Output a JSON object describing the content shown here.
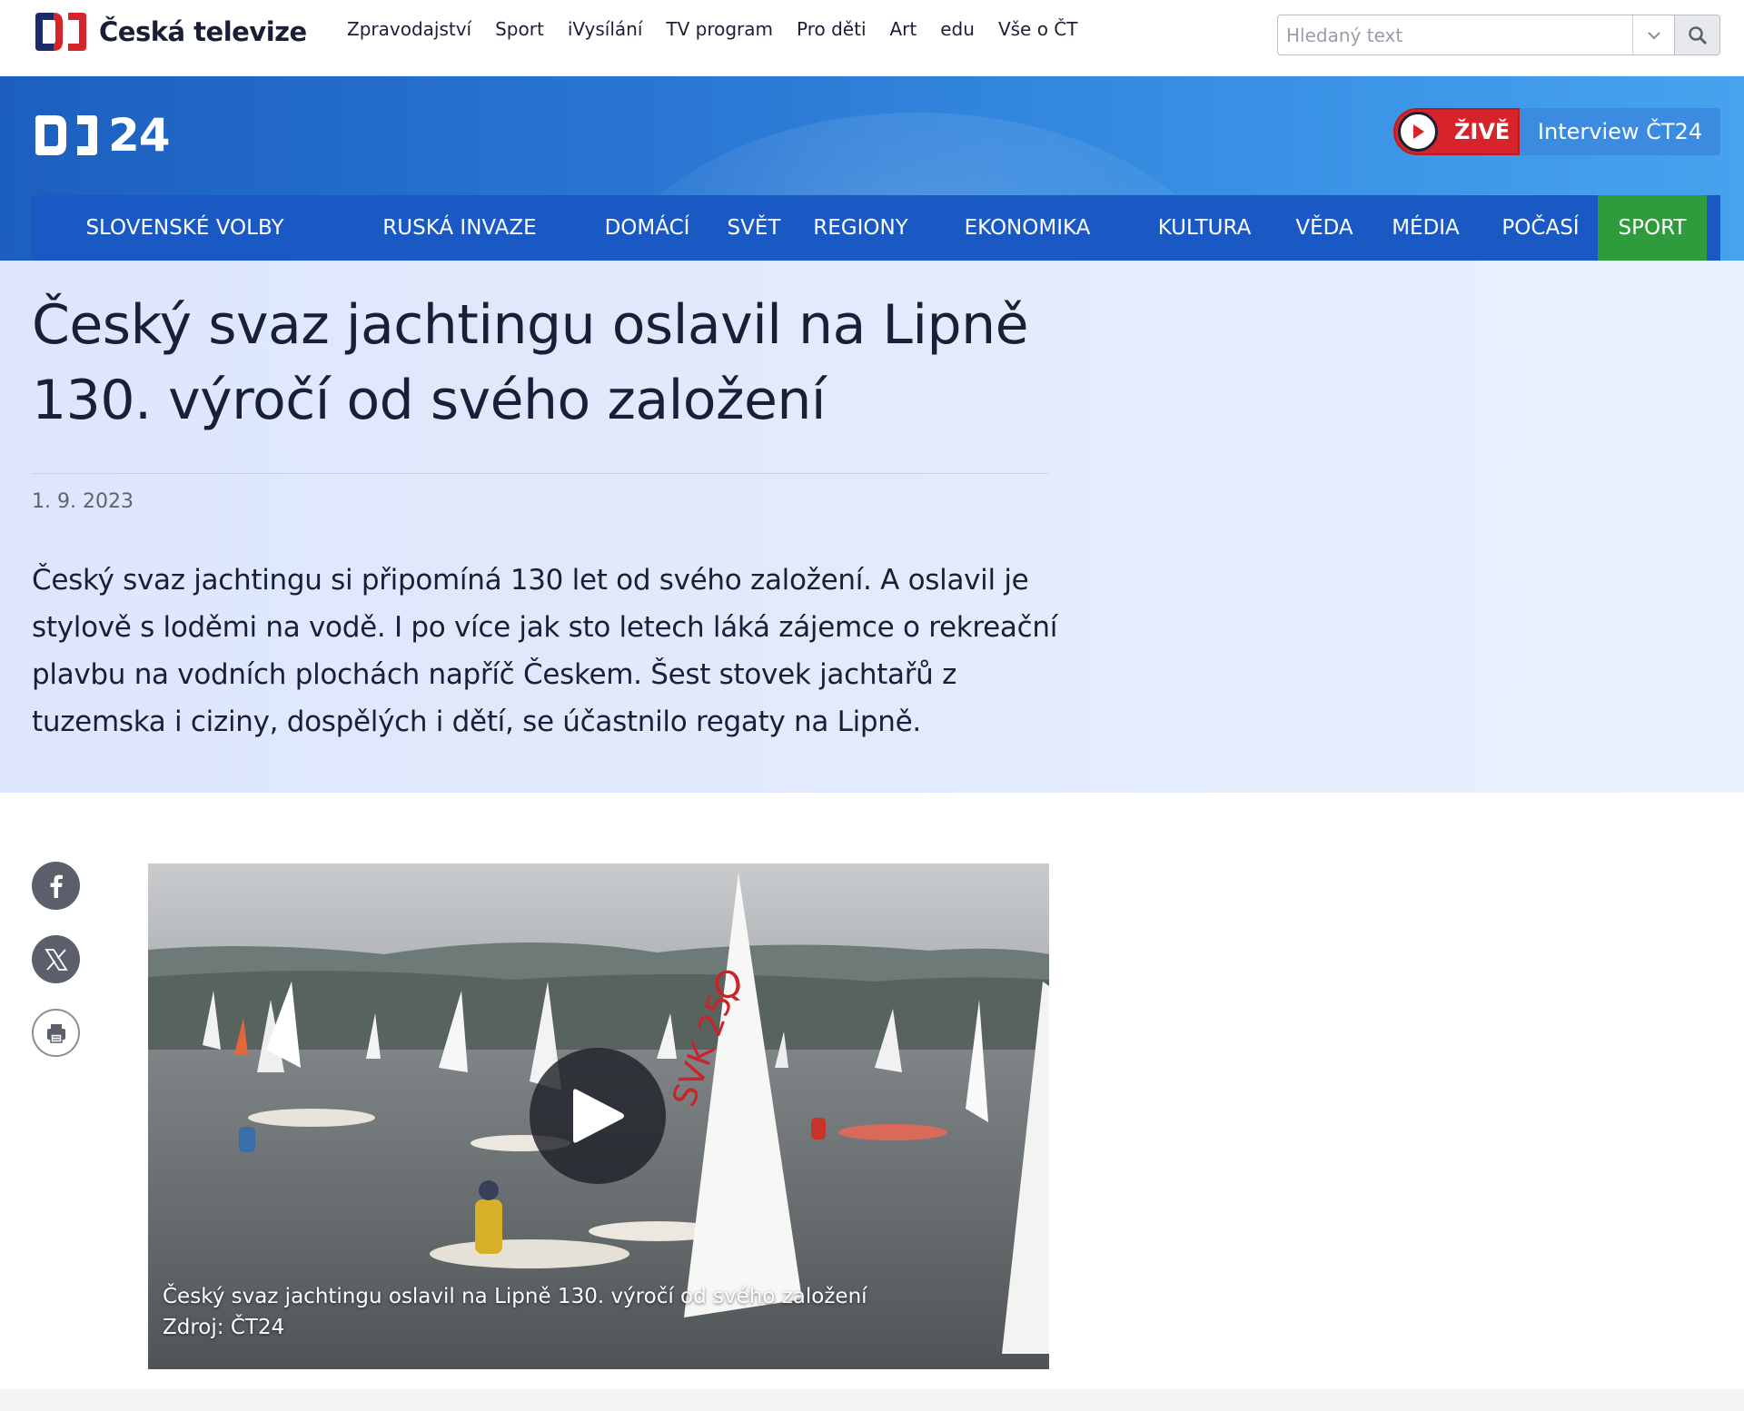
{
  "topbar": {
    "brand": "Česká televize",
    "nav": [
      "Zpravodajství",
      "Sport",
      "iVysílání",
      "TV program",
      "Pro děti",
      "Art",
      "edu",
      "Vše o ČT"
    ],
    "search_placeholder": "Hledaný text"
  },
  "header": {
    "logo_text": "24",
    "live_label": "ŽIVĚ",
    "interview_label": "Interview ČT24"
  },
  "sections": [
    "SLOVENSKÉ VOLBY",
    "RUSKÁ INVAZE",
    "DOMÁCÍ",
    "SVĚT",
    "REGIONY",
    "EKONOMIKA",
    "KULTURA",
    "VĚDA",
    "MÉDIA",
    "POČASÍ",
    "SPORT"
  ],
  "article": {
    "title": "Český svaz jachtingu oslavil na Lipně 130. výročí od svého založení",
    "date": "1. 9. 2023",
    "perex": "Český svaz jachtingu si připomíná 130 let od svého založení.  A oslavil je stylově s loděmi na vodě. I po více jak sto letech láká zájemce o rekreační plavbu na vodních plochách napříč Českem. Šest stovek jachtařů z tuzemska i ciziny, dospělých i dětí, se účastnilo regaty na Lipně."
  },
  "video": {
    "caption_title": "Český svaz jachtingu oslavil na Lipně 130. výročí od svého založení",
    "caption_source": "Zdroj: ČT24"
  },
  "colors": {
    "brand_red": "#d7242a",
    "nav_blue": "#1a58c4",
    "sport_green": "#2e9b3c",
    "text_dark": "#1b1f36"
  }
}
